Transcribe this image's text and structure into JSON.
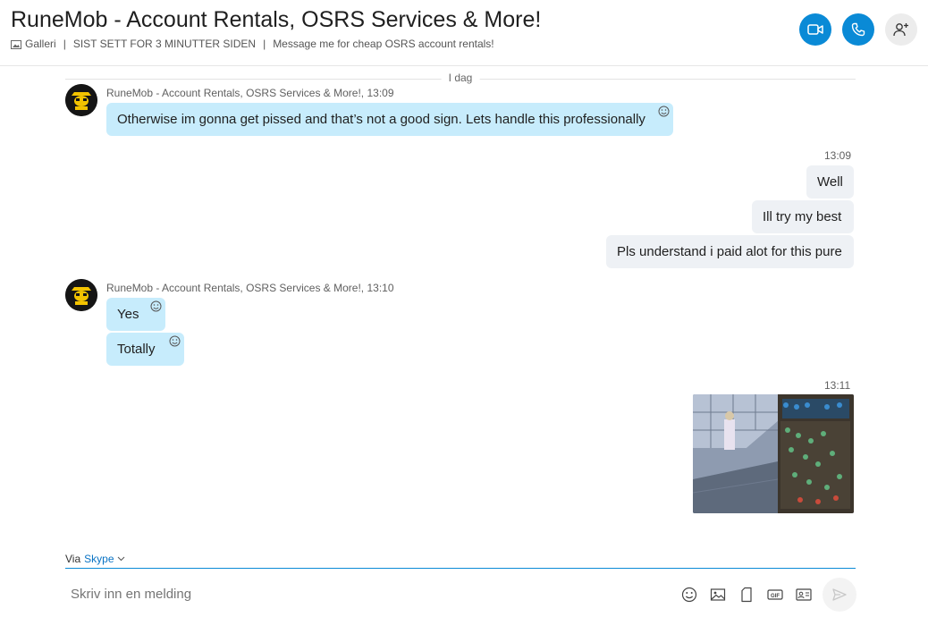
{
  "header": {
    "title": "RuneMob - Account Rentals, OSRS Services & More!",
    "gallery_label": "Galleri",
    "last_seen": "SIST SETT FOR 3 MINUTTER SIDEN",
    "mood": "Message me for cheap OSRS account rentals!"
  },
  "divider": {
    "label": "I dag"
  },
  "group1": {
    "sender": "RuneMob - Account Rentals, OSRS Services & More!,",
    "time": "13:09",
    "messages": [
      "Otherwise im gonna get pissed and that’s not a good sign. Lets handle this professionally"
    ]
  },
  "outgoing1": {
    "time": "13:09",
    "messages": [
      "Well",
      "Ill try my best",
      "Pls understand i paid alot for this pure"
    ]
  },
  "group2": {
    "sender": "RuneMob - Account Rentals, OSRS Services & More!,",
    "time": "13:10",
    "messages": [
      "Yes",
      "Totally"
    ]
  },
  "outgoing2": {
    "time": "13:11"
  },
  "footer": {
    "via_label": "Via",
    "via_service": "Skype",
    "placeholder": "Skriv inn en melding"
  },
  "colors": {
    "accent": "#0a8ad6",
    "incoming_bubble": "#c7ecfc",
    "outgoing_bubble": "#eef1f5"
  },
  "icons": [
    "gallery-icon",
    "video-call-icon",
    "phone-icon",
    "add-person-icon",
    "emoji-react-icon",
    "emoji-icon",
    "image-icon",
    "file-icon",
    "gif-icon",
    "contact-card-icon",
    "send-icon",
    "chevron-down-icon"
  ]
}
